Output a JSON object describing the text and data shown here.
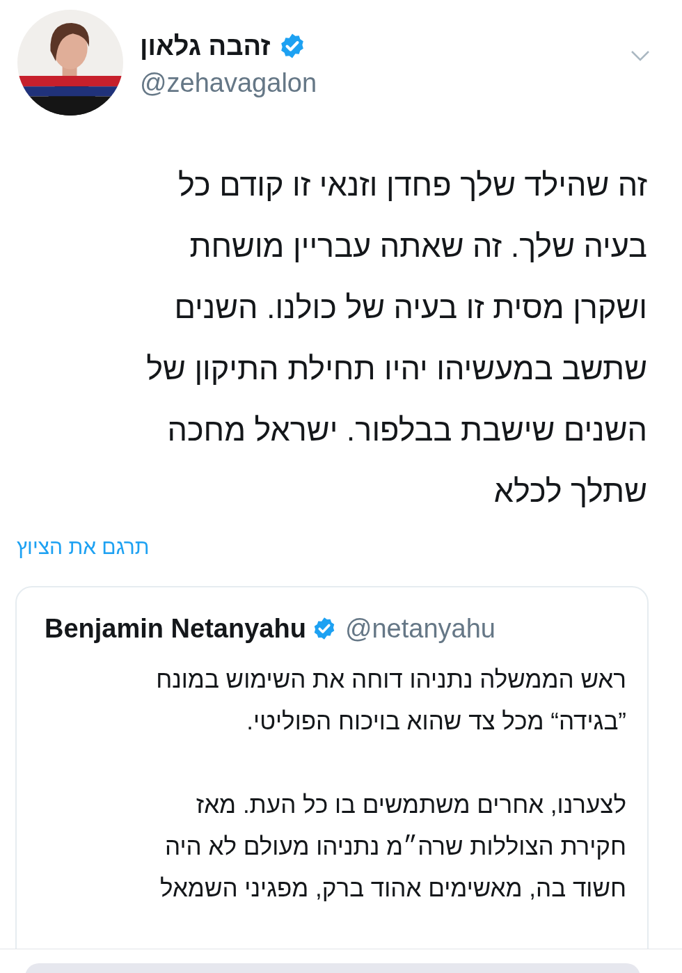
{
  "author": {
    "name": "זהבה גלאון",
    "verified": true,
    "handle": "@zehavagalon"
  },
  "tweet": {
    "text_lines": [
      "זה שהילד שלך פחדן וזנאי זו קודם כל",
      "בעיה שלך. זה שאתה עבריין מושחת",
      "ושקרן מסית זו בעיה של כולנו. השנים",
      "שתשב במעשיהו יהיו תחילת התיקון של",
      "השנים שישבת בבלפור. ישראל מחכה",
      "שתלך לכלא"
    ]
  },
  "translate_link": "תרגם את הציוץ",
  "quoted_tweet": {
    "author": {
      "name": "Benjamin Netanyahu",
      "verified": true,
      "handle": "@netanyahu"
    },
    "paragraphs": [
      [
        "ראש הממשלה נתניהו דוחה את השימוש במונח",
        "”בגידה“ מכל צד שהוא בויכוח הפוליטי."
      ],
      [
        "לצערנו, אחרים משתמשים בו כל העת. מאז",
        "חקירת הצוללות שרה״מ נתניהו מעולם לא היה",
        "חשוד בה, מאשימים אהוד ברק, מפגיני השמאל"
      ]
    ]
  }
}
